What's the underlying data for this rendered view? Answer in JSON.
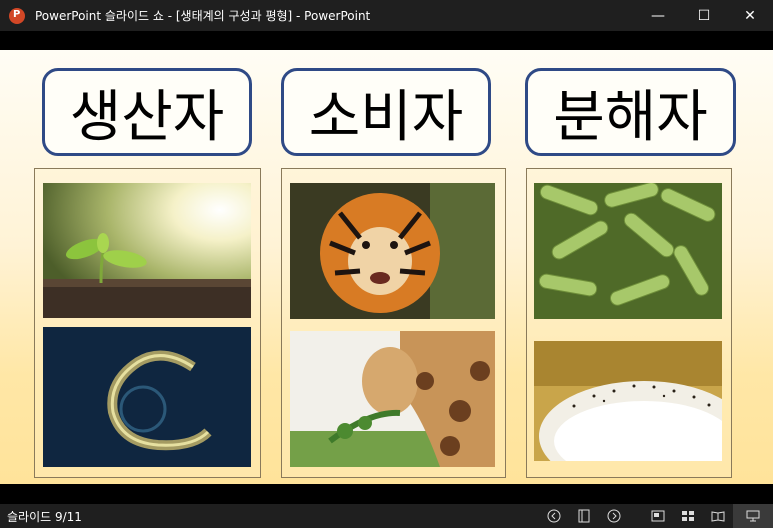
{
  "window": {
    "app_icon_letter": "P",
    "title": "PowerPoint 슬라이드 쇼 - [생태계의 구성과 평형] - PowerPoint",
    "minimize_glyph": "—",
    "maximize_glyph": "☐",
    "close_glyph": "✕"
  },
  "slide": {
    "headers": [
      "생산자",
      "소비자",
      "분해자"
    ]
  },
  "status": {
    "slide_indicator": "슬라이드 9/11"
  },
  "colors": {
    "header_border": "#2f4a86",
    "titlebar": "#1f1f1f"
  }
}
